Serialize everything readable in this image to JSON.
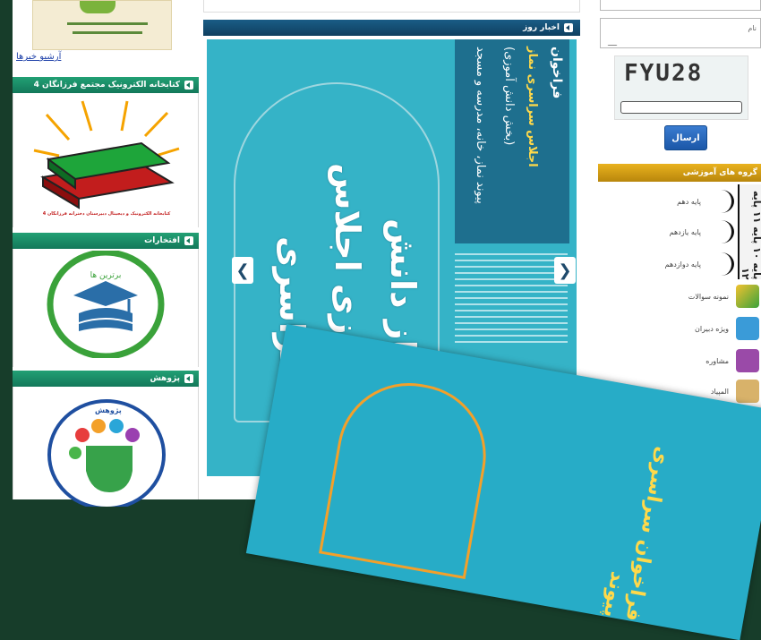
{
  "left": {
    "archive_link": "آرشیو خبرها",
    "library_title": "کتابخانه الکترونیک مجتمع فرزانگان 4",
    "library_caption": "کتابخانه الکترونیک و دیجیتال دبیرستان دخترانه فرزانگان 4",
    "achievements_title": "افتخارات",
    "research_title": "پژوهش",
    "research_logo_text": "پژوهش"
  },
  "center": {
    "news_title": "اخبار روز",
    "poster": {
      "line1": "فراخوان",
      "line2": "اجلاس سراسری نماز",
      "line3": "(بخش دانش آموزی)",
      "line4": "پیوند نماز، خانه، مدرسه و مسجد",
      "calligraphy": "نماز دانش آموزی اجلاس سراسری"
    },
    "prev": "❮",
    "next": "❯"
  },
  "overlay": {
    "text": "فراخوان سراسری پیوند"
  },
  "right": {
    "name_label": "نام",
    "captcha_code": "FYU28",
    "send_label": "ارسال",
    "groups_title": "گروه های آموزشی",
    "grade_strip": "پایه ۱۰ پایه ۱۱ پایه ۱۲",
    "groups": [
      {
        "label": "پایه دهم",
        "color": "#ffffff"
      },
      {
        "label": "پایه یازدهم",
        "color": "#ffffff"
      },
      {
        "label": "پایه دوازدهم",
        "color": "#ffffff"
      },
      {
        "label": "نمونه سوالات",
        "color": "#f2c230"
      },
      {
        "label": "ویژه دبیران",
        "color": "#3a9bd8"
      },
      {
        "label": "مشاوره",
        "color": "#9a4aa8"
      },
      {
        "label": "المپیاد",
        "color": "#d8b26a"
      }
    ]
  }
}
